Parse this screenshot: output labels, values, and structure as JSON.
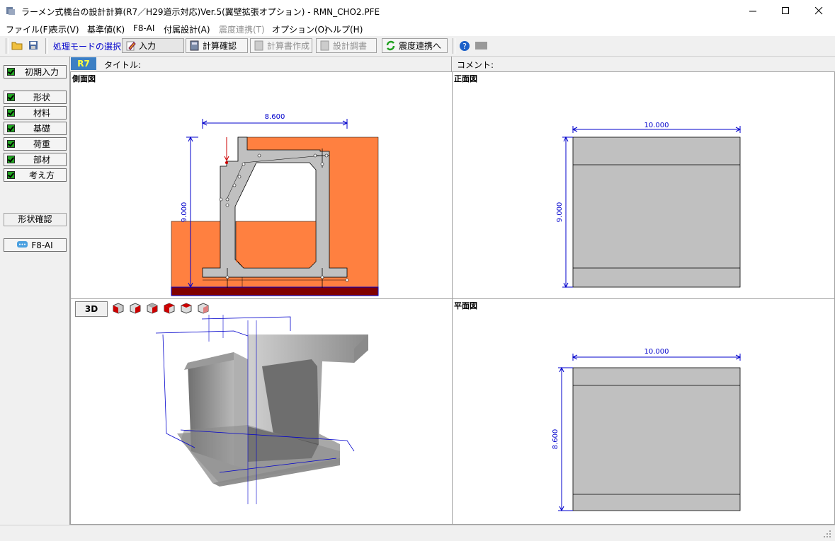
{
  "window": {
    "title": "ラーメン式橋台の設計計算(R7／H29道示対応)Ver.5(翼壁拡張オプション) - RMN_CHO2.PFE",
    "minimize": "—",
    "maximize": "☐",
    "close": "✕"
  },
  "menu": [
    "ファイル(F)",
    "表示(V)",
    "基準値(K)",
    "F8-AI",
    "付属設計(A)",
    "震度連携(T)",
    "オプション(O)",
    "ヘルプ(H)"
  ],
  "toolbar": {
    "mode_label": "処理モードの選択",
    "input": "入力",
    "calc_check": "計算確認",
    "report": "計算書作成",
    "design_sheet": "設計調書",
    "seismic_link": "震度連携へ"
  },
  "header": {
    "version_badge": "R7",
    "title_label": "タイトル:",
    "comment_label": "コメント:"
  },
  "left": {
    "initial_input": "初期入力",
    "items": [
      "形状",
      "材料",
      "基礎",
      "荷重",
      "部材",
      "考え方"
    ],
    "shape_check": "形状確認",
    "f8ai": "F8-AI"
  },
  "panes": {
    "side_view": "側面図",
    "front_view": "正面図",
    "plan_view": "平面図",
    "view3d_button": "3D"
  },
  "dims": {
    "side_width": "8.600",
    "side_height": "9.000",
    "front_width": "10.000",
    "front_height": "9.000",
    "plan_width": "10.000",
    "plan_height": "8.600"
  },
  "colors": {
    "soil": "#ff8040",
    "concrete": "#c0c0c0",
    "foundation": "#800000",
    "dimension": "#0000cc",
    "badge": "#3b7fc4"
  }
}
